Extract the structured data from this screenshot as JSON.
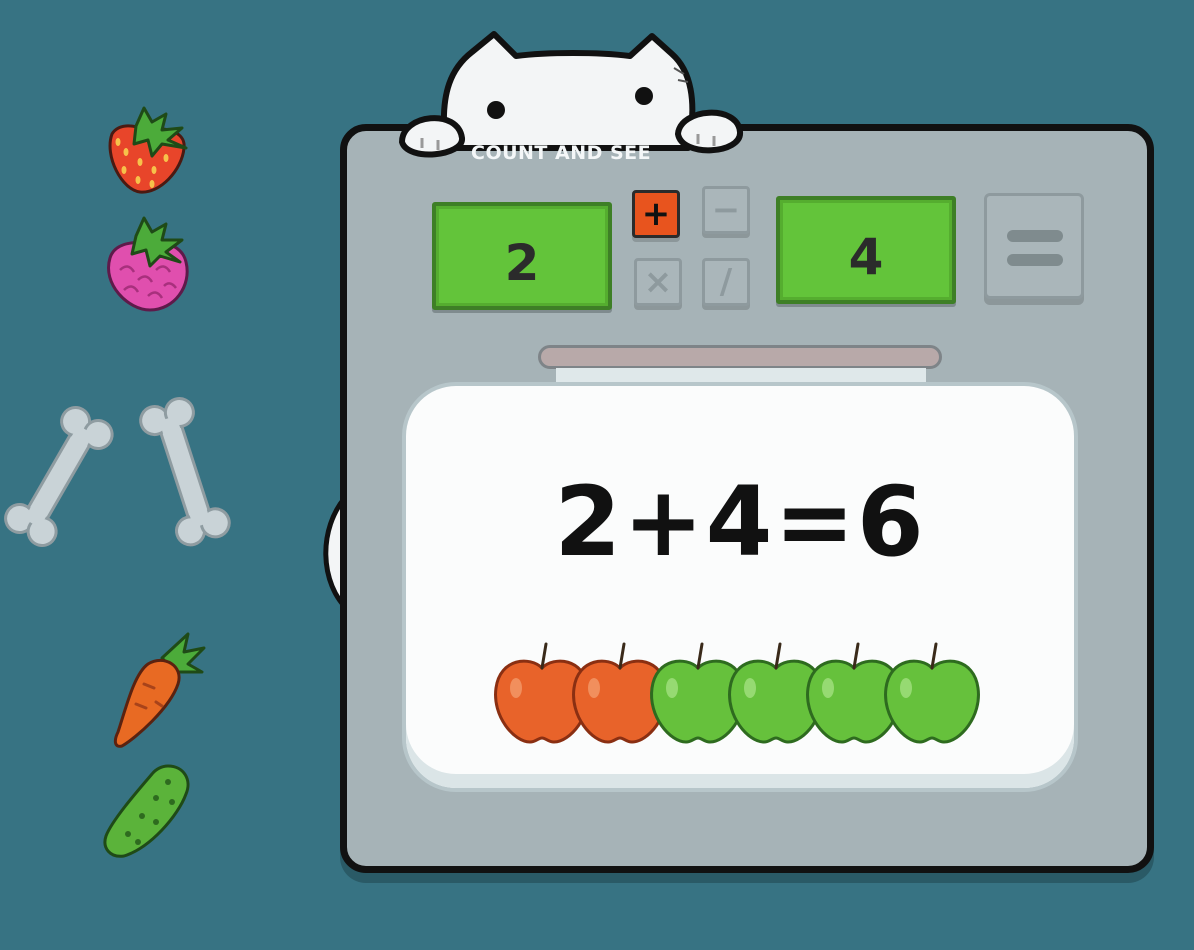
{
  "game": {
    "title": "COUNT AND SEE",
    "first_operand": "2",
    "second_operand": "4",
    "selected_operator": "+",
    "operators": [
      "+",
      "−",
      "×",
      "/"
    ],
    "equation": {
      "left": "2",
      "op": "+",
      "right": "4",
      "eq": "=",
      "result": "6"
    },
    "equals_button": "equals"
  },
  "side_items": [
    {
      "name": "strawberry",
      "icon": "strawberry-icon",
      "color": "#e8452a"
    },
    {
      "name": "raspberry",
      "icon": "raspberry-icon",
      "color": "#e04fae"
    },
    {
      "name": "bone",
      "icon": "bone-icon",
      "color": "#c9d3d7"
    },
    {
      "name": "bone",
      "icon": "bone-icon",
      "color": "#c9d3d7"
    },
    {
      "name": "carrot",
      "icon": "carrot-icon",
      "color": "#e86a23"
    },
    {
      "name": "pickle",
      "icon": "pickle-icon",
      "color": "#5bb33a"
    }
  ],
  "jar_fruits": [
    {
      "kind": "red-apple",
      "color": "#e8632a"
    },
    {
      "kind": "red-apple",
      "color": "#e8632a"
    },
    {
      "kind": "green-apple",
      "color": "#66c13c"
    },
    {
      "kind": "green-apple",
      "color": "#66c13c"
    },
    {
      "kind": "green-apple",
      "color": "#66c13c"
    },
    {
      "kind": "green-apple",
      "color": "#66c13c"
    }
  ],
  "colors": {
    "background": "#377383",
    "panel": "#a6b3b7",
    "screen": "#63c43a",
    "active_operator": "#e8541e"
  }
}
